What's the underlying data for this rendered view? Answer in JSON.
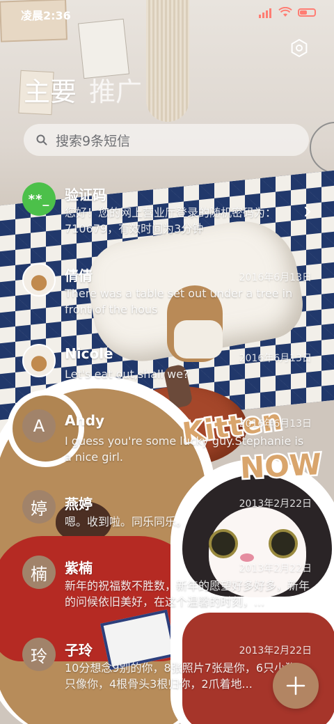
{
  "status_bar": {
    "time": "凌晨2:36"
  },
  "header": {
    "tabs": [
      {
        "label": "主要"
      },
      {
        "label": "推广"
      }
    ]
  },
  "search": {
    "placeholder": "搜索9条短信"
  },
  "background": {
    "sticker_title_1": "Kitten",
    "sticker_title_2": "NOW"
  },
  "conversations": [
    {
      "avatar_text": "**_",
      "avatar_type": "green",
      "name": "验证码",
      "date": "",
      "preview": "您好！您的网上营业厅登录的随机密码为：710679，有效时间为3分钟"
    },
    {
      "avatar_text": "",
      "avatar_type": "photo",
      "name": "倩倩",
      "date": "2016年6月13日",
      "preview": "There was a table set out under a tree in front of the hous"
    },
    {
      "avatar_text": "",
      "avatar_type": "photo",
      "name": "Nicole",
      "date": "2016年6月13日",
      "preview": "Let's eat out,shall we?"
    },
    {
      "avatar_text": "A",
      "avatar_type": "letter",
      "name": "Andy",
      "date": "2016年6月13日",
      "preview": "I guess you're some lucky guy.Stephanie is a nice girl."
    },
    {
      "avatar_text": "婷",
      "avatar_type": "letter",
      "name": "燕婷",
      "date": "2013年2月22日",
      "preview": "嗯。收到啦。同乐同乐。"
    },
    {
      "avatar_text": "楠",
      "avatar_type": "letter",
      "name": "紫楠",
      "date": "2013年2月22日",
      "preview": "新年的祝福数不胜数，新年的愿望好多好多，新年的问候依旧美好，在这个温馨的时刻，..."
    },
    {
      "avatar_text": "玲",
      "avatar_type": "letter",
      "name": "子玲",
      "date": "2013年2月22日",
      "preview": "10分想念9别的你，8张照片7张是你，6只小狗5只像你，4根骨头3根归你，2爪着地..."
    }
  ],
  "colors": {
    "accent": "#b28563",
    "avatar_letter_bg": "#a1836a",
    "verify_green": "#4cc04a"
  },
  "icons": {
    "settings": "settings-icon",
    "search": "search-icon",
    "compose": "plus-icon",
    "chevron": "chevron-right-icon"
  }
}
